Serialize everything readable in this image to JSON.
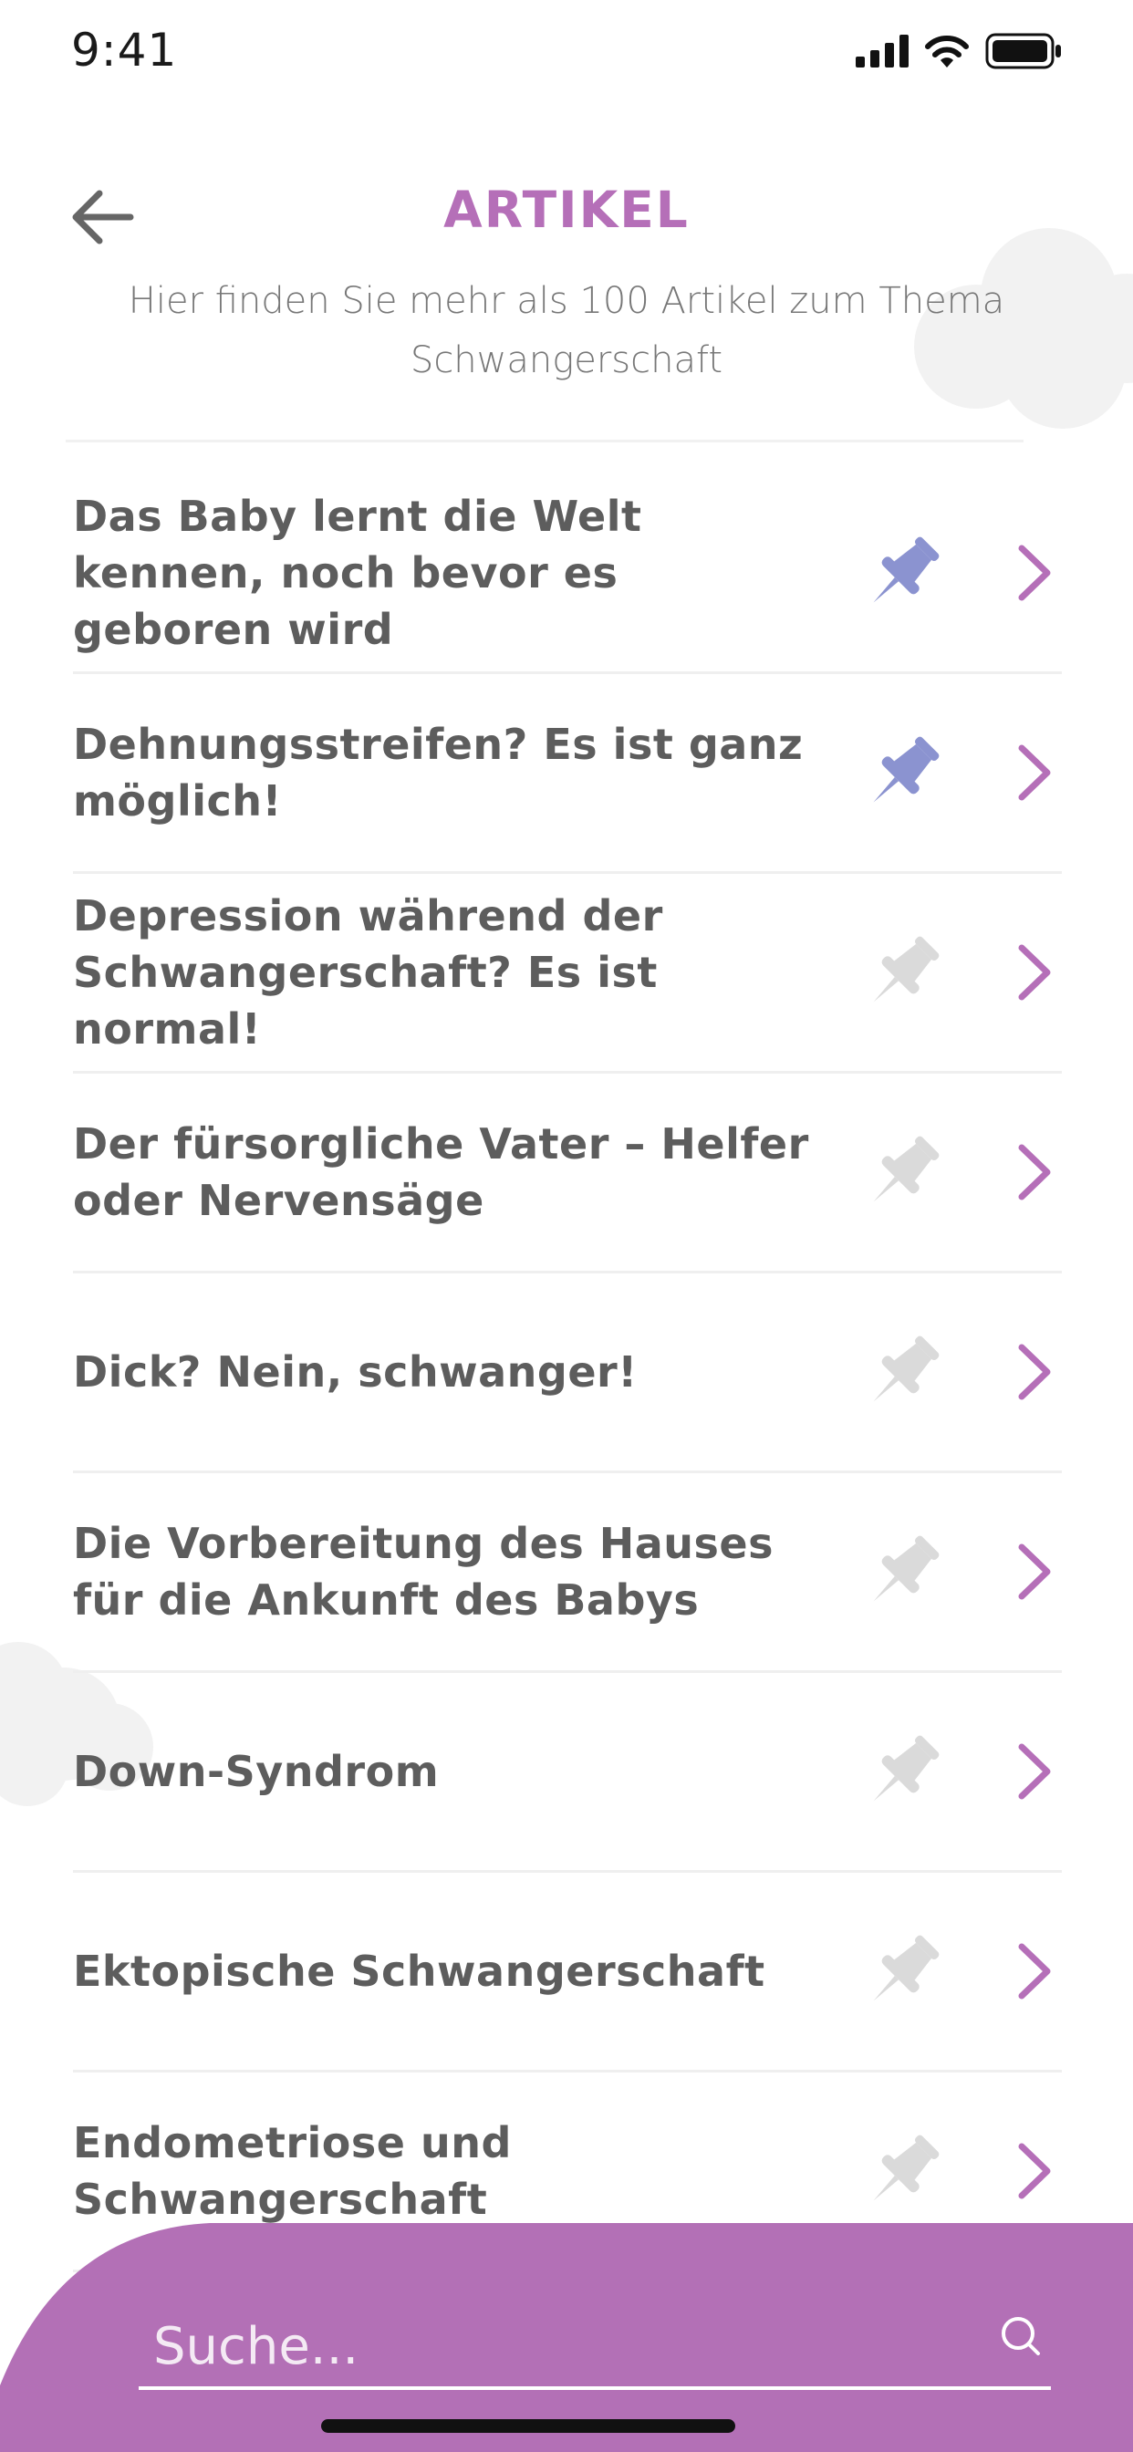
{
  "status_bar": {
    "time": "9:41"
  },
  "header": {
    "title": "ARTIKEL",
    "subtitle": "Hier finden Sie mehr als 100 Artikel zum Thema Schwangerschaft"
  },
  "colors": {
    "accent": "#b56fb8",
    "pin_active": "#8b93d0",
    "pin_inactive": "#dadada",
    "panel": "#b370b6"
  },
  "articles": [
    {
      "title": "Das Baby lernt die Welt kennen, noch bevor es geboren wird",
      "pinned": true
    },
    {
      "title": "Dehnungsstreifen? Es ist ganz möglich!",
      "pinned": true
    },
    {
      "title": "Depression während der Schwangerschaft? Es ist normal!",
      "pinned": false
    },
    {
      "title": "Der fürsorgliche Vater – Helfer oder Nervensäge",
      "pinned": false
    },
    {
      "title": "Dick? Nein, schwanger!",
      "pinned": false
    },
    {
      "title": "Die Vorbereitung des Hauses für die Ankunft des Babys",
      "pinned": false
    },
    {
      "title": "Down-Syndrom",
      "pinned": false
    },
    {
      "title": "Ektopische Schwangerschaft",
      "pinned": false
    },
    {
      "title": "Endometriose und Schwangerschaft",
      "pinned": false
    }
  ],
  "search": {
    "placeholder": "Suche..."
  },
  "icons": {
    "back": "arrow-left-icon",
    "pin": "pushpin-icon",
    "chevron": "chevron-right-icon",
    "search": "search-icon"
  }
}
